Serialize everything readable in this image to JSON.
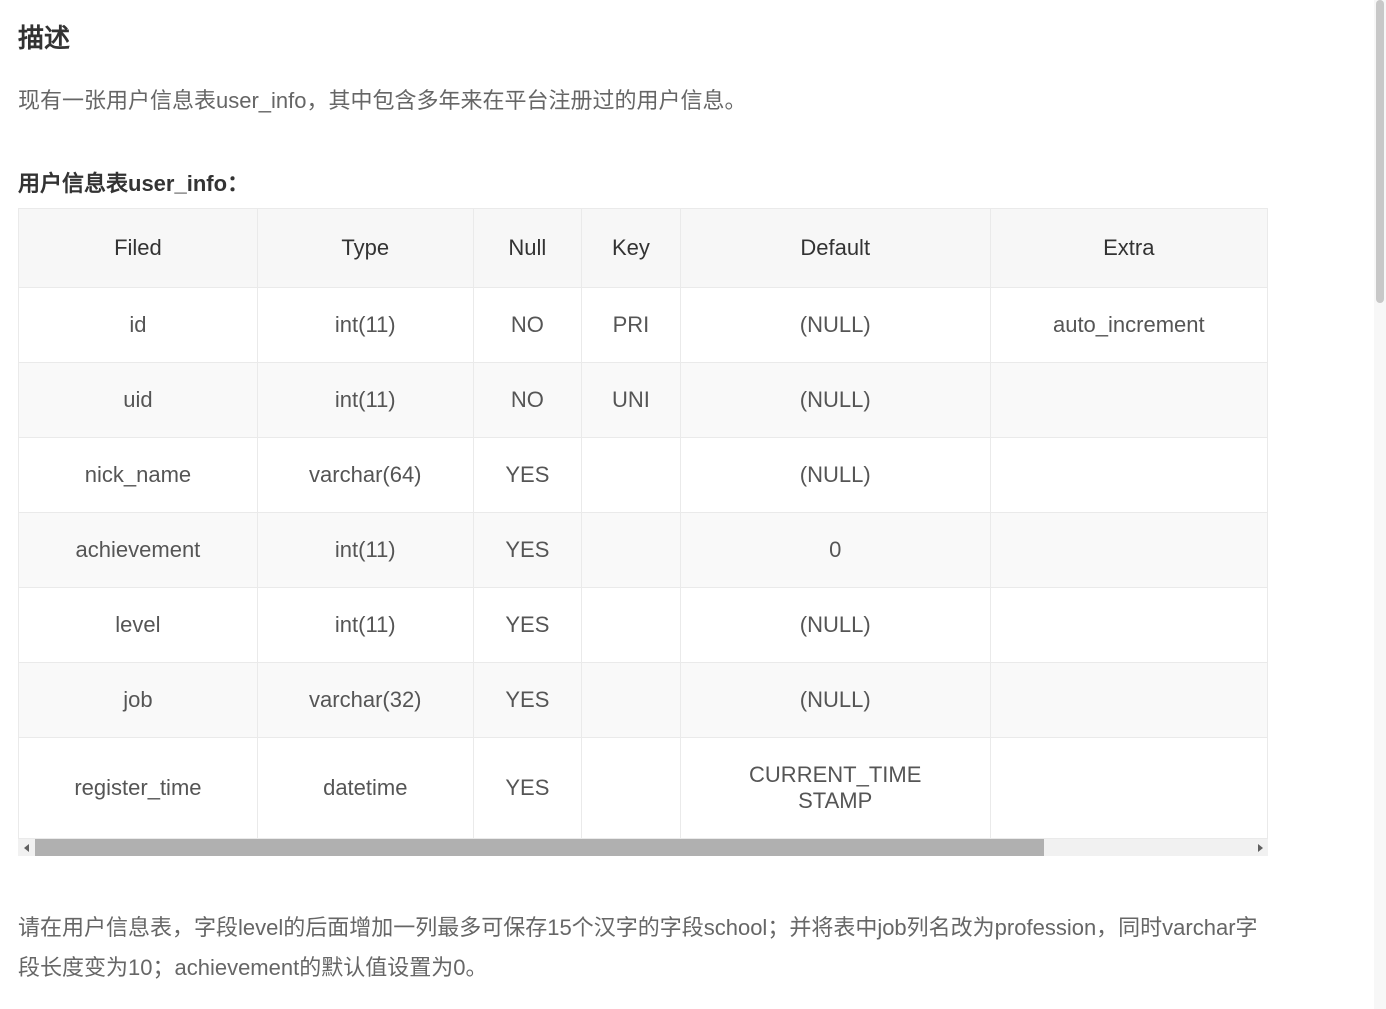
{
  "section_title": "描述",
  "description": "现有一张用户信息表user_info，其中包含多年来在平台注册过的用户信息。",
  "table_title": "用户信息表user_info：",
  "table": {
    "headers": [
      "Filed",
      "Type",
      "Null",
      "Key",
      "Default",
      "Extra"
    ],
    "rows": [
      [
        "id",
        "int(11)",
        "NO",
        "PRI",
        "(NULL)",
        "auto_increment"
      ],
      [
        "uid",
        "int(11)",
        "NO",
        "UNI",
        "(NULL)",
        ""
      ],
      [
        "nick_name",
        "varchar(64)",
        "YES",
        "",
        "(NULL)",
        ""
      ],
      [
        "achievement",
        "int(11)",
        "YES",
        "",
        "0",
        ""
      ],
      [
        "level",
        "int(11)",
        "YES",
        "",
        "(NULL)",
        ""
      ],
      [
        "job",
        "varchar(32)",
        "YES",
        "",
        "(NULL)",
        ""
      ],
      [
        "register_time",
        "datetime",
        "YES",
        "",
        "CURRENT_TIMESTAMP",
        ""
      ]
    ]
  },
  "instruction": "请在用户信息表，字段level的后面增加一列最多可保存15个汉字的字段school；并将表中job列名改为profession，同时varchar字段长度变为10；achievement的默认值设置为0。"
}
